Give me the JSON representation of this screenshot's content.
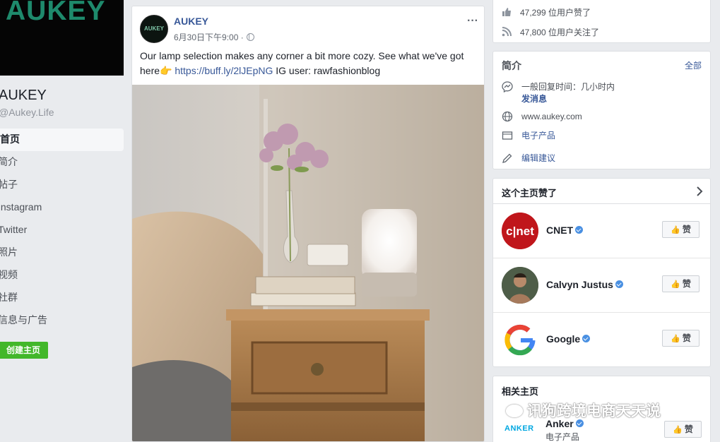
{
  "cover": {
    "logo_text": "AUKEY"
  },
  "page": {
    "name": "AUKEY",
    "handle": "@Aukey.Life"
  },
  "nav": {
    "items": [
      "首页",
      "简介",
      "帖子",
      "Instagram",
      "Twitter",
      "照片",
      "视频",
      "社群",
      "信息与广告"
    ]
  },
  "create_page_label": "创建主页",
  "post": {
    "avatar_text": "AUKEY",
    "author": "AUKEY",
    "time": "6月30日下午9:00 ·",
    "more": "···",
    "text_before": "Our lamp selection makes any corner a bit more cozy. See what we've got here👉 ",
    "link": "https://buff.ly/2lJEpNG",
    "text_after": " IG user: rawfashionblog"
  },
  "stats": {
    "likes": "47,299 位用户赞了",
    "follows": "47,800 位用户关注了"
  },
  "about": {
    "title": "简介",
    "see_all": "全部",
    "reply_time": "一般回复时间：几小时内",
    "send_message": "发消息",
    "website": "www.aukey.com",
    "category": "电子产品",
    "suggest_edits": "编辑建议"
  },
  "liked_pages": {
    "title": "这个主页赞了",
    "like_label": "赞",
    "items": [
      {
        "name": "CNET"
      },
      {
        "name": "Calvyn Justus"
      },
      {
        "name": "Google"
      }
    ]
  },
  "related": {
    "title": "相关主页",
    "name": "Anker",
    "category": "电子产品",
    "logo_text": "ANKER",
    "like_label": "赞"
  },
  "watermark": "讯狗跨境电商天天说",
  "colors": {
    "link": "#385898",
    "create_button": "#42b72a",
    "verified": "#4a90e2",
    "cnet_red": "#c0161b"
  }
}
